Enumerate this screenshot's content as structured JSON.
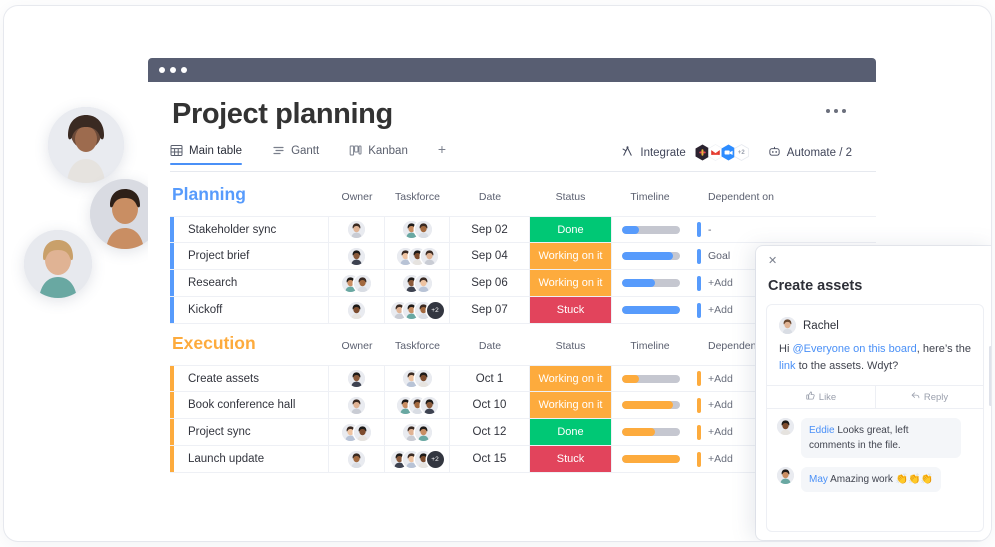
{
  "window": {
    "dots_count": 3,
    "titlebar_color": "#585e72"
  },
  "board": {
    "title": "Project planning",
    "menu_icon": "ellipsis-icon",
    "tabs": [
      {
        "label": "Main table",
        "icon": "table-icon",
        "active": true
      },
      {
        "label": "Gantt",
        "icon": "gantt-icon",
        "active": false
      },
      {
        "label": "Kanban",
        "icon": "kanban-icon",
        "active": false
      }
    ],
    "add_tab_label": "+",
    "toolbar": {
      "integrate_label": "Integrate",
      "integrate_icon": "integrate-icon",
      "integration_badges": [
        "slack-icon",
        "gmail-icon",
        "zoom-icon"
      ],
      "integration_more": "+2",
      "automate_label": "Automate / 2",
      "automate_icon": "robot-icon"
    }
  },
  "columns": [
    "Owner",
    "Taskforce",
    "Date",
    "Status",
    "Timeline",
    "Dependent on"
  ],
  "groups": [
    {
      "name": "Planning",
      "color": "#579bfc",
      "show_dependent_column": true,
      "rows": [
        {
          "name": "Stakeholder sync",
          "owner_count": 1,
          "taskforce_count": 2,
          "taskforce_more": "",
          "date": "Sep 02",
          "status": "Done",
          "status_color": "#00c875",
          "timeline_pct": 30,
          "dependent": "-"
        },
        {
          "name": "Project brief",
          "owner_count": 1,
          "taskforce_count": 3,
          "taskforce_more": "",
          "date": "Sep 04",
          "status": "Working on it",
          "status_color": "#fdab3d",
          "timeline_pct": 88,
          "dependent": "Goal"
        },
        {
          "name": "Research",
          "owner_count": 2,
          "taskforce_count": 2,
          "taskforce_more": "",
          "date": "Sep 06",
          "status": "Working on it",
          "status_color": "#fdab3d",
          "timeline_pct": 58,
          "dependent": "+Add"
        },
        {
          "name": "Kickoff",
          "owner_count": 1,
          "taskforce_count": 3,
          "taskforce_more": "+2",
          "date": "Sep 07",
          "status": "Stuck",
          "status_color": "#e2445c",
          "timeline_pct": 100,
          "dependent": "+Add"
        }
      ]
    },
    {
      "name": "Execution",
      "color": "#fdab3d",
      "show_dependent_column": true,
      "rows": [
        {
          "name": "Create assets",
          "owner_count": 1,
          "taskforce_count": 2,
          "taskforce_more": "",
          "date": "Oct 1",
          "status": "Working on it",
          "status_color": "#fdab3d",
          "timeline_pct": 30,
          "dependent": "+Add"
        },
        {
          "name": "Book conference hall",
          "owner_count": 1,
          "taskforce_count": 3,
          "taskforce_more": "",
          "date": "Oct 10",
          "status": "Working on it",
          "status_color": "#fdab3d",
          "timeline_pct": 88,
          "dependent": "+Add"
        },
        {
          "name": "Project sync",
          "owner_count": 2,
          "taskforce_count": 2,
          "taskforce_more": "",
          "date": "Oct 12",
          "status": "Done",
          "status_color": "#00c875",
          "timeline_pct": 58,
          "dependent": "+Add"
        },
        {
          "name": "Launch update",
          "owner_count": 1,
          "taskforce_count": 3,
          "taskforce_more": "+2",
          "date": "Oct 15",
          "status": "Stuck",
          "status_color": "#e2445c",
          "timeline_pct": 100,
          "dependent": "+Add"
        }
      ]
    }
  ],
  "popup": {
    "close_icon": "close-icon",
    "title": "Create assets",
    "update": {
      "author": "Rachel",
      "author_avatar": "avatar-rachel",
      "text_prefix": "Hi ",
      "mention": "@Everyone on this board",
      "text_middle": ", here’s the ",
      "link": "link",
      "text_suffix": " to the assets. Wdyt?",
      "like_label": "Like",
      "like_icon": "thumbs-up-icon",
      "reply_label": "Reply",
      "reply_icon": "reply-arrow-icon"
    },
    "replies": [
      {
        "who": "Eddie",
        "text": " Looks great, left comments in the file.",
        "avatar": "avatar-eddie"
      },
      {
        "who": "May",
        "text": " Amazing work 👏👏👏",
        "avatar": "avatar-may"
      }
    ]
  },
  "floating_avatars": [
    {
      "name": "avatar-person-1"
    },
    {
      "name": "avatar-person-2"
    },
    {
      "name": "avatar-person-3"
    }
  ]
}
